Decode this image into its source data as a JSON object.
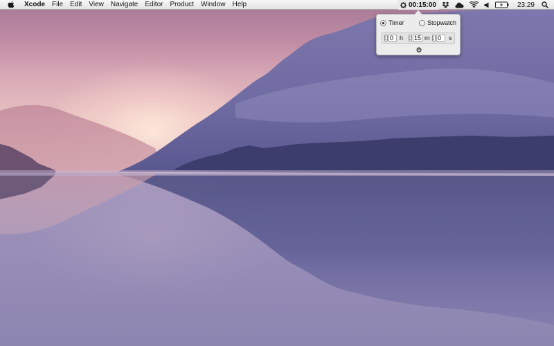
{
  "menubar": {
    "app_name": "Xcode",
    "menus": [
      "File",
      "Edit",
      "View",
      "Navigate",
      "Editor",
      "Product",
      "Window",
      "Help"
    ],
    "timer_readout": "00:15:00",
    "battery_icon": "battery-icon",
    "clock": "23:29"
  },
  "popover": {
    "modes": {
      "timer_label": "Timer",
      "stopwatch_label": "Stopwatch",
      "selected": "Timer"
    },
    "fields": {
      "hours_value": "0",
      "hours_unit": "h",
      "minutes_value": "15",
      "minutes_unit": "m",
      "seconds_value": "0",
      "seconds_unit": "s"
    },
    "power_icon": "power-icon"
  },
  "colors": {
    "menubar_top": "#f7f7f7",
    "menubar_bottom": "#e4e4e4",
    "popover_bg": "#ececec"
  }
}
